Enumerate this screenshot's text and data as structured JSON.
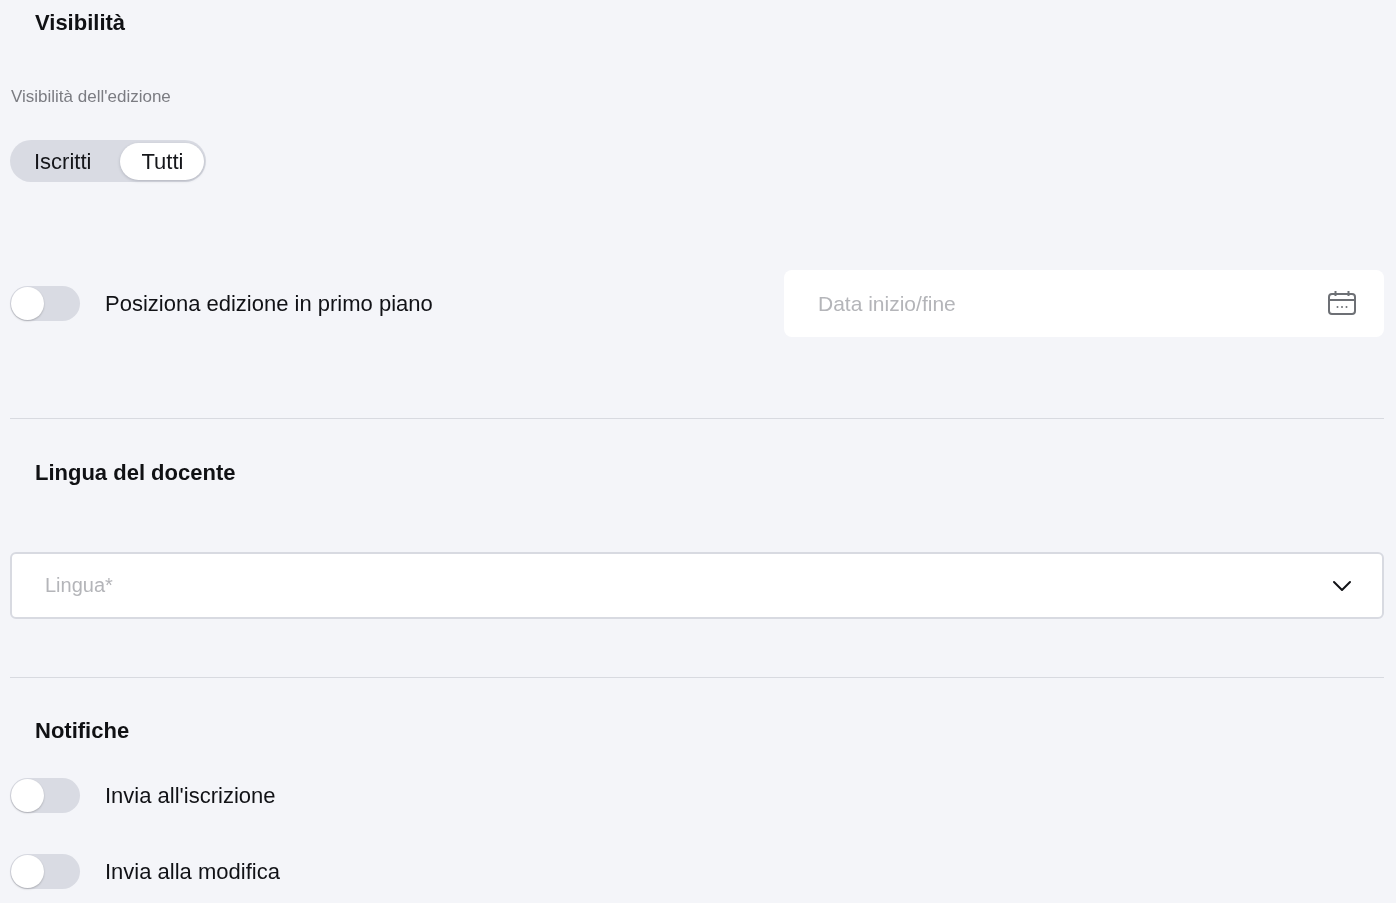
{
  "visibility": {
    "title": "Visibilità",
    "field_label": "Visibilità dell'edizione",
    "segments": [
      {
        "label": "Iscritti",
        "selected": false
      },
      {
        "label": "Tutti",
        "selected": true
      }
    ],
    "featured_toggle": {
      "label": "Posiziona edizione in primo piano",
      "on": false
    },
    "date_field": {
      "placeholder": "Data inizio/fine"
    }
  },
  "teacher_language": {
    "title": "Lingua del docente",
    "language_select": {
      "placeholder": "Lingua*"
    }
  },
  "notifications": {
    "title": "Notifiche",
    "toggles": [
      {
        "label": "Invia all'iscrizione",
        "on": false
      },
      {
        "label": "Invia alla modifica",
        "on": false
      }
    ]
  }
}
